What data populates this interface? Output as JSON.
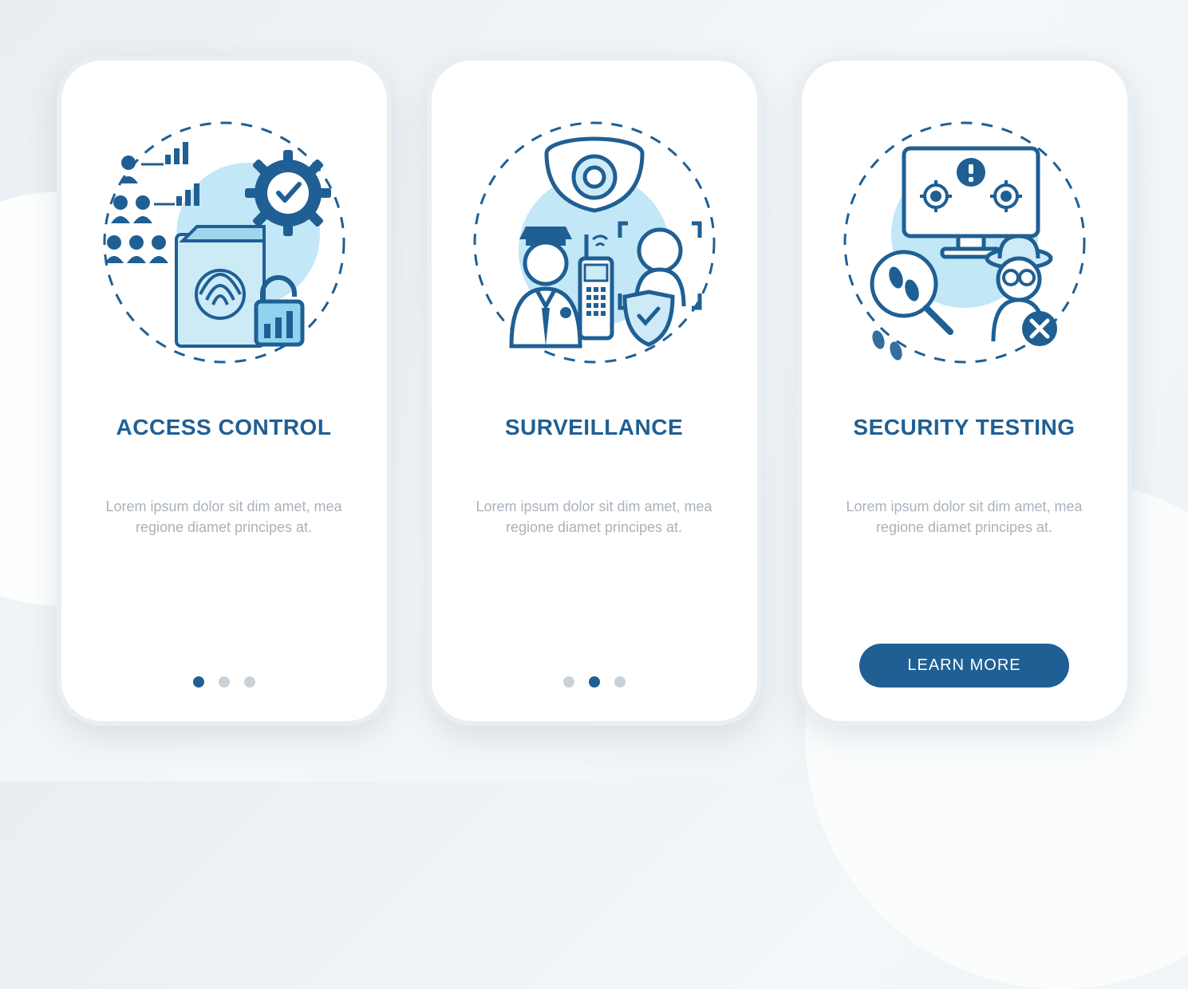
{
  "colors": {
    "primary": "#1f5f94",
    "accent_light": "#8fd3f1",
    "muted": "#a9b2bb"
  },
  "screens": [
    {
      "title": "ACCESS CONTROL",
      "description": "Lorem ipsum dolor sit dim amet, mea regione diamet principes at.",
      "illustration": "access-control-illustration",
      "pager": {
        "total": 3,
        "active": 0
      },
      "cta": null
    },
    {
      "title": "SURVEILLANCE",
      "description": "Lorem ipsum dolor sit dim amet, mea regione diamet principes at.",
      "illustration": "surveillance-illustration",
      "pager": {
        "total": 3,
        "active": 1
      },
      "cta": null
    },
    {
      "title": "SECURITY TESTING",
      "description": "Lorem ipsum dolor sit dim amet, mea regione diamet principes at.",
      "illustration": "security-testing-illustration",
      "pager": null,
      "cta": "LEARN MORE"
    }
  ]
}
